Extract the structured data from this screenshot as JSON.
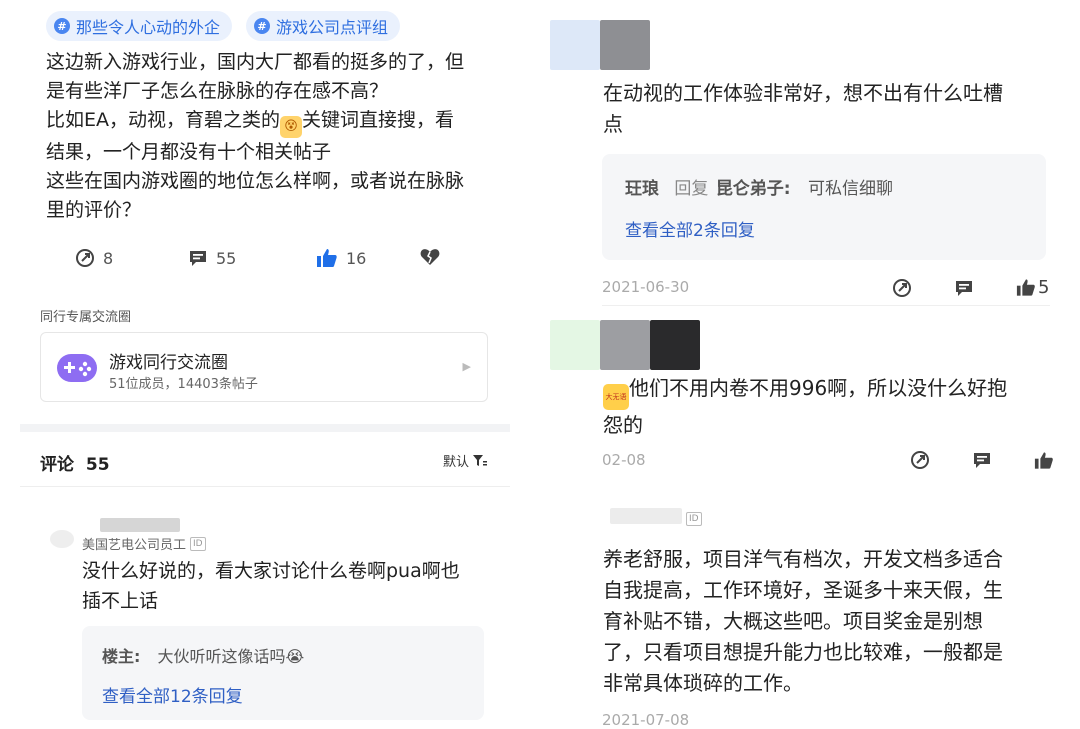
{
  "post": {
    "tags": [
      "那些令人心动的外企",
      "游戏公司点评组"
    ],
    "lines": [
      "这边新入游戏行业，国内大厂都看的挺多的了，但",
      "是有些洋厂子怎么在脉脉的存在感不高？",
      "比如EA，动视，育碧之类的",
      "关键词直接搜，看",
      "结果，一个月都没有十个相关帖子",
      "这些在国内游戏圈的地位怎么样啊，或者说在脉脉",
      "里的评价？"
    ],
    "actions": {
      "share": "8",
      "comment": "55",
      "like": "16"
    }
  },
  "circle": {
    "section_label": "同行专属交流圈",
    "title": "游戏同行交流圈",
    "meta": "51位成员，14403条帖子"
  },
  "comments_header": {
    "label": "评论",
    "count": "55",
    "sort_label": "默认"
  },
  "left_comment": {
    "company": "美国艺电公司员工",
    "id_badge": "ID",
    "lines": [
      "没什么好说的，看大家讨论什么卷啊pua啊也",
      "插不上话"
    ],
    "reply_author": "楼主:",
    "reply_text": "大伙听听这像话吗",
    "view_all": "查看全部12条回复"
  },
  "right_comment_1": {
    "lines": [
      "在动视的工作体验非常好，想不出有什么吐槽",
      "点"
    ],
    "reply_from": "玨琅",
    "reply_word": "回复",
    "reply_to": "昆仑弟子:",
    "reply_text": "可私信细聊",
    "view_all": "查看全部2条回复",
    "date": "2021-06-30",
    "like_count": "5"
  },
  "right_comment_2": {
    "emoji_text": "大无语",
    "lines": [
      "他们不用内卷不用996啊，所以没什么好抱",
      "怨的"
    ],
    "date": "02-08"
  },
  "right_comment_3": {
    "id_badge": "ID",
    "lines": [
      "养老舒服，项目洋气有档次，开发文档多适合",
      "自我提高，工作环境好，圣诞多十来天假，生",
      "育补贴不错，大概这些吧。项目奖金是别想",
      "了，只看项目想提升能力也比较难，一般都是",
      "非常具体琐碎的工作。"
    ],
    "date": "2021-07-08"
  },
  "colors": {
    "accent_blue": "#2f6fe0",
    "link_blue": "#2f5fc4",
    "like_blue": "#1f6fe8",
    "reply_bg": "#f5f6f8"
  }
}
